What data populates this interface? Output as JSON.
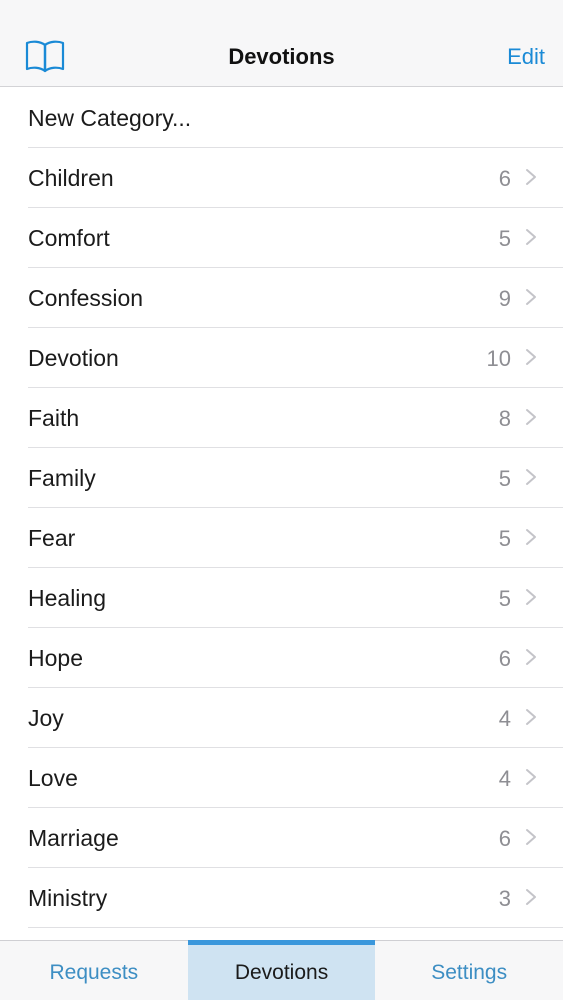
{
  "nav": {
    "title": "Devotions",
    "edit_label": "Edit",
    "left_icon": "book-icon",
    "accent_color": "#1a8ad6"
  },
  "list": {
    "new_category_label": "New Category...",
    "items": [
      {
        "label": "Children",
        "count": "6"
      },
      {
        "label": "Comfort",
        "count": "5"
      },
      {
        "label": "Confession",
        "count": "9"
      },
      {
        "label": "Devotion",
        "count": "10"
      },
      {
        "label": "Faith",
        "count": "8"
      },
      {
        "label": "Family",
        "count": "5"
      },
      {
        "label": "Fear",
        "count": "5"
      },
      {
        "label": "Healing",
        "count": "5"
      },
      {
        "label": "Hope",
        "count": "6"
      },
      {
        "label": "Joy",
        "count": "4"
      },
      {
        "label": "Love",
        "count": "4"
      },
      {
        "label": "Marriage",
        "count": "6"
      },
      {
        "label": "Ministry",
        "count": "3"
      }
    ]
  },
  "tabbar": {
    "tabs": [
      {
        "label": "Requests",
        "selected": false
      },
      {
        "label": "Devotions",
        "selected": true
      },
      {
        "label": "Settings",
        "selected": false
      }
    ],
    "selected_color": "#cfe3f2",
    "indicator_color": "#3a97dc"
  }
}
